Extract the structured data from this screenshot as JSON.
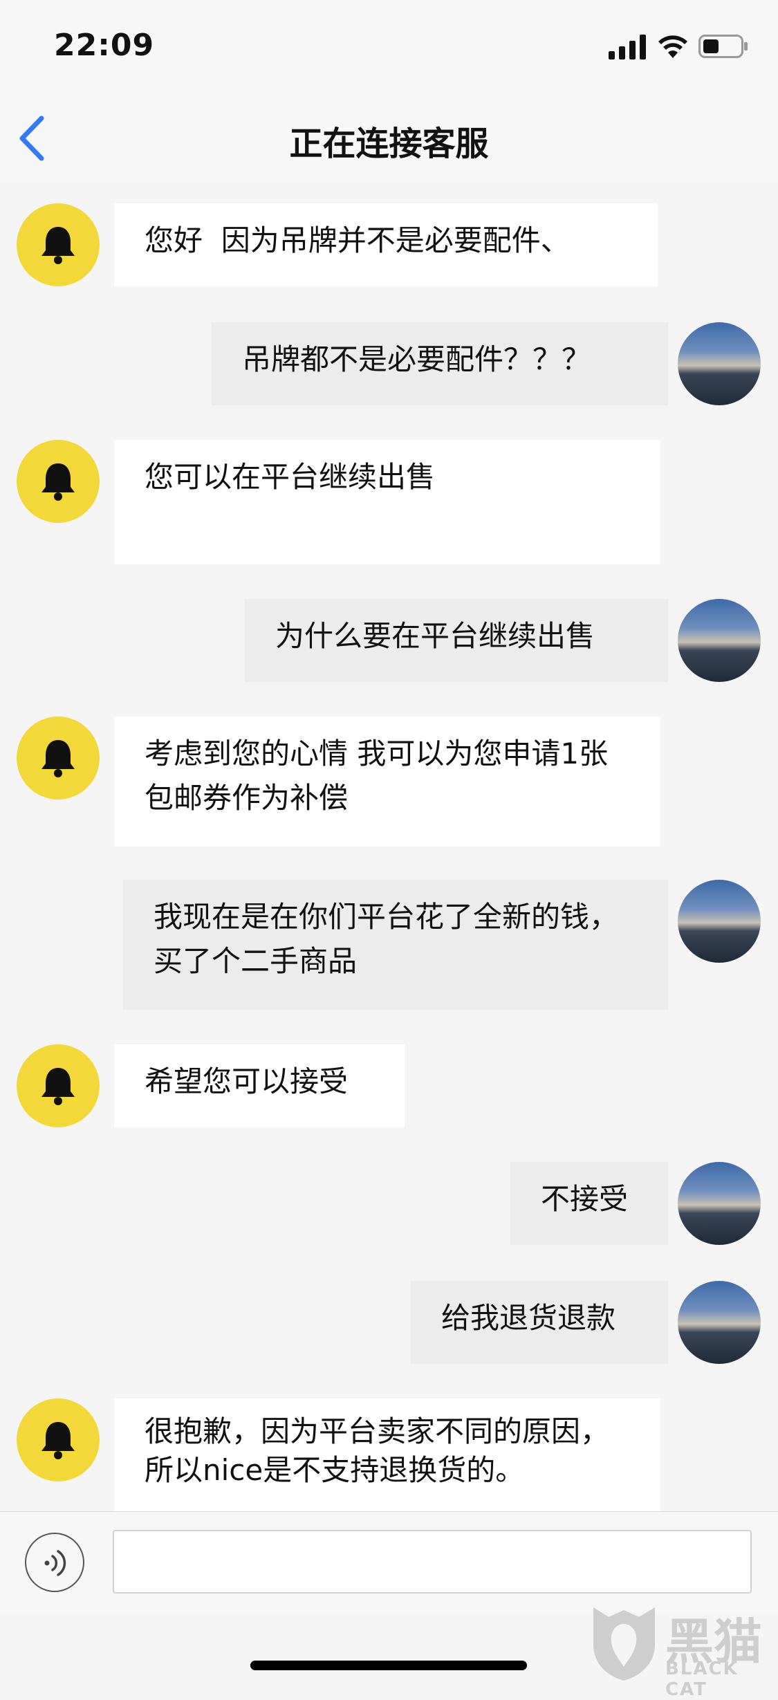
{
  "status_bar": {
    "time": "22:09"
  },
  "nav": {
    "title": "正在连接客服"
  },
  "messages": [
    {
      "sender": "bot",
      "text": "您好  因为吊牌并不是必要配件、"
    },
    {
      "sender": "user",
      "text": "吊牌都不是必要配件？？？"
    },
    {
      "sender": "bot",
      "text": "您可以在平台继续出售"
    },
    {
      "sender": "user",
      "text": "为什么要在平台继续出售"
    },
    {
      "sender": "bot",
      "text": "考虑到您的心情 我可以为您申请1张包邮券作为补偿"
    },
    {
      "sender": "user",
      "text": "我现在是在你们平台花了全新的钱，买了个二手商品"
    },
    {
      "sender": "bot",
      "text": "希望您可以接受"
    },
    {
      "sender": "user",
      "text": "不接受"
    },
    {
      "sender": "user",
      "text": "给我退货退款"
    },
    {
      "sender": "bot",
      "text": "很抱歉，因为平台卖家不同的原因，所以nice是不支持退换货的。"
    }
  ],
  "input": {
    "value": "",
    "placeholder": ""
  },
  "watermark": {
    "brand_cn": "黑猫",
    "brand_en": "BLACK CAT"
  },
  "colors": {
    "bot_avatar": "#f3d83a",
    "back_arrow": "#2f7cf6",
    "bot_bubble": "#ffffff",
    "user_bubble": "#ececec"
  }
}
